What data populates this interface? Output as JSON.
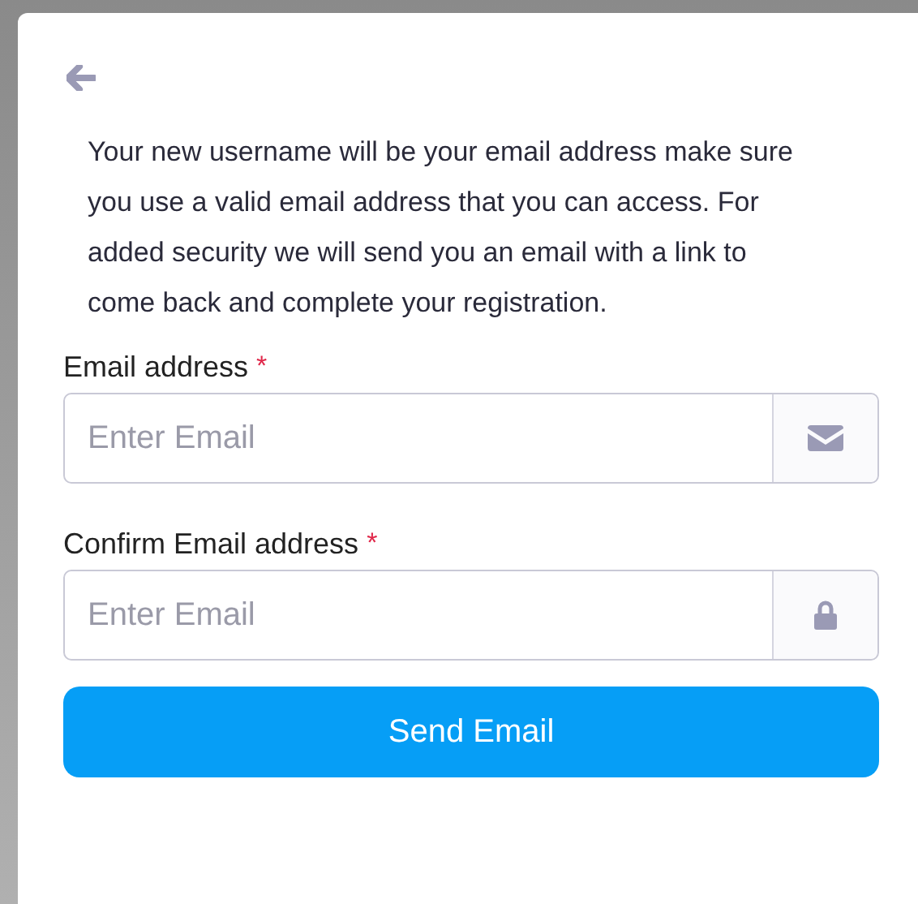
{
  "intro": "Your new username will be your email address make sure you use a valid email address that you can access. For added security we will send you an email with a link to come back and complete your registration.",
  "fields": [
    {
      "label": "Email address",
      "required_mark": "*",
      "placeholder": "Enter Email",
      "kind": "email"
    },
    {
      "label": "Confirm Email address",
      "required_mark": "*",
      "placeholder": "Enter Email",
      "kind": "secure"
    }
  ],
  "submit": "Send Email"
}
